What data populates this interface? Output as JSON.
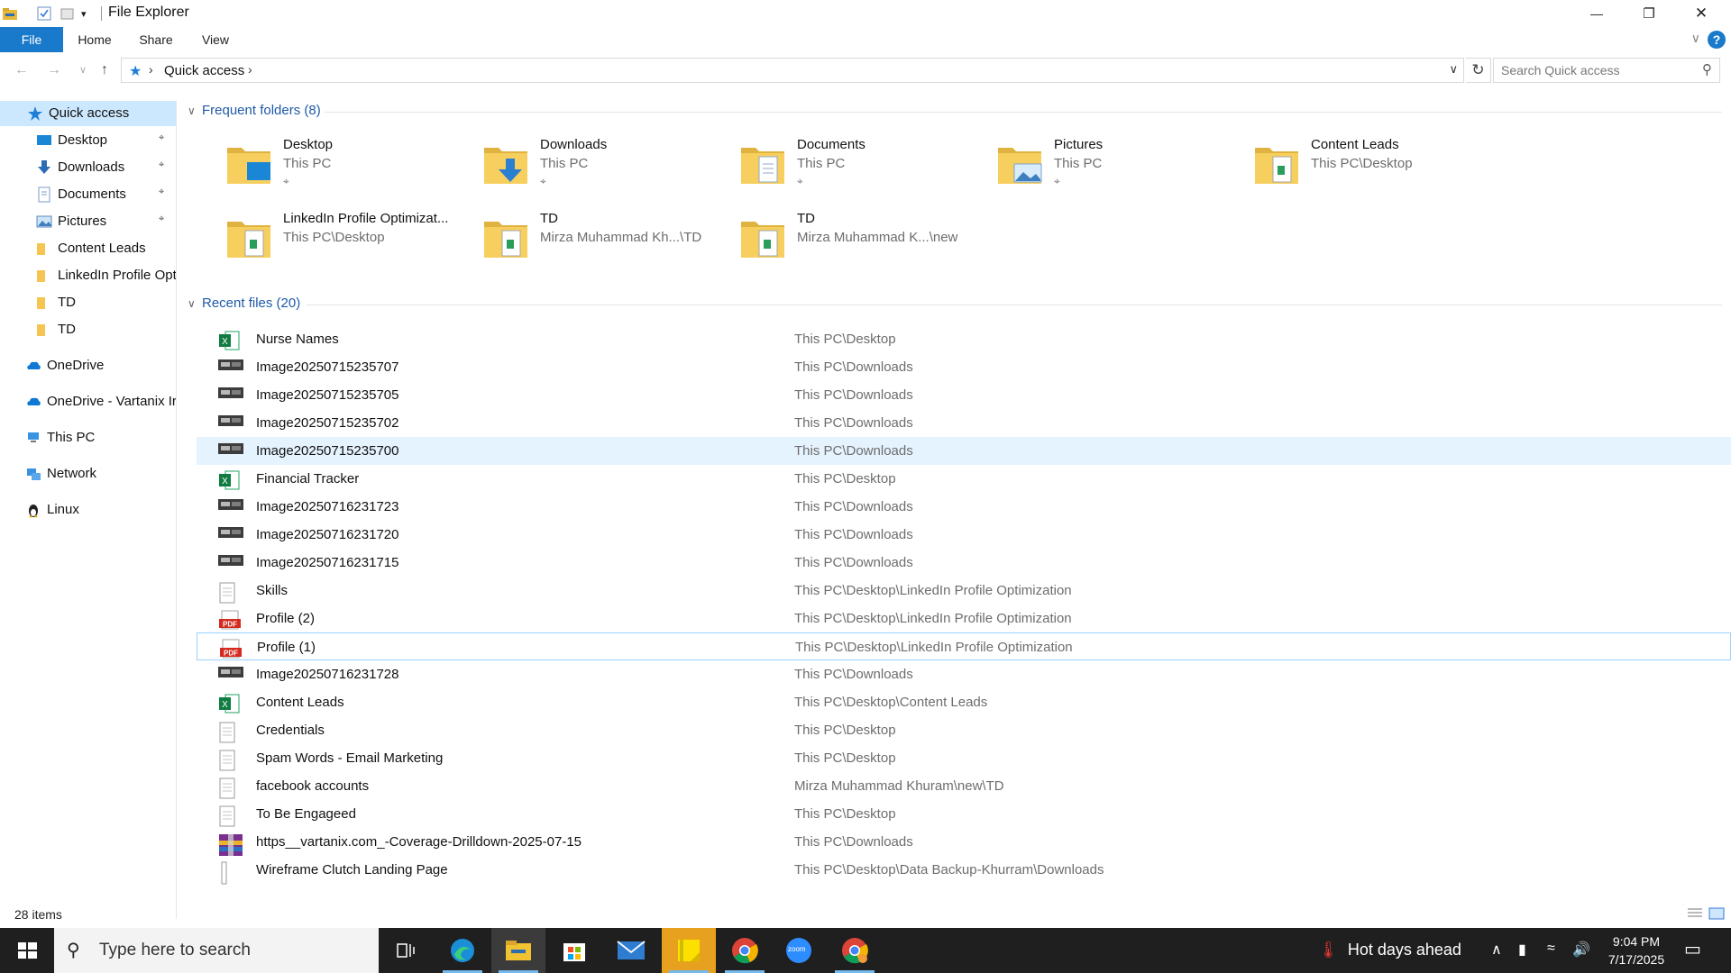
{
  "window": {
    "title": "File Explorer",
    "minimize": "—",
    "maximize": "❐",
    "close": "✕"
  },
  "ribbon": {
    "tabs": [
      "File",
      "Home",
      "Share",
      "View"
    ],
    "help": "?",
    "collapse": "∨"
  },
  "address": {
    "path": "Quick access",
    "chevron": "›",
    "dropdown": "∨",
    "refresh": "↻",
    "search_placeholder": "Search Quick access",
    "search_icon": "⌕",
    "back": "←",
    "forward": "→",
    "recent": "∨",
    "up": "↑"
  },
  "nav": {
    "items": [
      {
        "label": "Quick access",
        "icon": "quick-access-star-icon",
        "selected": true
      },
      {
        "label": "Desktop",
        "icon": "desktop-icon",
        "pinned": true
      },
      {
        "label": "Downloads",
        "icon": "downloads-icon",
        "pinned": true
      },
      {
        "label": "Documents",
        "icon": "documents-icon",
        "pinned": true
      },
      {
        "label": "Pictures",
        "icon": "pictures-icon",
        "pinned": true
      },
      {
        "label": "Content Leads",
        "icon": "folder-icon"
      },
      {
        "label": "LinkedIn Profile Opt",
        "icon": "folder-icon"
      },
      {
        "label": "TD",
        "icon": "folder-icon"
      },
      {
        "label": "TD",
        "icon": "folder-icon"
      },
      {
        "label": "OneDrive",
        "icon": "onedrive-icon"
      },
      {
        "label": "OneDrive - Vartanix Ir",
        "icon": "onedrive-icon"
      },
      {
        "label": "This PC",
        "icon": "this-pc-icon"
      },
      {
        "label": "Network",
        "icon": "network-icon"
      },
      {
        "label": "Linux",
        "icon": "linux-icon"
      }
    ],
    "pin_glyph": "📌"
  },
  "frequent": {
    "header": "Frequent folders (8)",
    "folders": [
      {
        "name": "Desktop",
        "path": "This PC",
        "pinned": true,
        "icon": "desktop-folder-icon"
      },
      {
        "name": "Downloads",
        "path": "This PC",
        "pinned": true,
        "icon": "downloads-folder-icon"
      },
      {
        "name": "Documents",
        "path": "This PC",
        "pinned": true,
        "icon": "documents-folder-icon"
      },
      {
        "name": "Pictures",
        "path": "This PC",
        "pinned": true,
        "icon": "pictures-folder-icon"
      },
      {
        "name": "Content Leads",
        "path": "This PC\\Desktop",
        "pinned": false,
        "icon": "folder-icon"
      },
      {
        "name": "LinkedIn Profile Optimizat...",
        "path": "This PC\\Desktop",
        "pinned": false,
        "icon": "folder-icon"
      },
      {
        "name": "TD",
        "path": "Mirza Muhammad Kh...\\TD",
        "pinned": false,
        "icon": "folder-icon"
      },
      {
        "name": "TD",
        "path": "Mirza Muhammad K...\\new",
        "pinned": false,
        "icon": "folder-icon"
      }
    ]
  },
  "recent": {
    "header": "Recent files (20)",
    "files": [
      {
        "name": "Nurse Names",
        "location": "This PC\\Desktop",
        "type": "excel"
      },
      {
        "name": "Image20250715235707",
        "location": "This PC\\Downloads",
        "type": "image"
      },
      {
        "name": "Image20250715235705",
        "location": "This PC\\Downloads",
        "type": "image"
      },
      {
        "name": "Image20250715235702",
        "location": "This PC\\Downloads",
        "type": "image"
      },
      {
        "name": "Image20250715235700",
        "location": "This PC\\Downloads",
        "type": "image",
        "hover": true
      },
      {
        "name": "Financial Tracker",
        "location": "This PC\\Desktop",
        "type": "excel"
      },
      {
        "name": "Image20250716231723",
        "location": "This PC\\Downloads",
        "type": "image"
      },
      {
        "name": "Image20250716231720",
        "location": "This PC\\Downloads",
        "type": "image"
      },
      {
        "name": "Image20250716231715",
        "location": "This PC\\Downloads",
        "type": "image"
      },
      {
        "name": "Skills",
        "location": "This PC\\Desktop\\LinkedIn Profile Optimization",
        "type": "text"
      },
      {
        "name": "Profile (2)",
        "location": "This PC\\Desktop\\LinkedIn Profile Optimization",
        "type": "pdf"
      },
      {
        "name": "Profile (1)",
        "location": "This PC\\Desktop\\LinkedIn Profile Optimization",
        "type": "pdf",
        "focus": true
      },
      {
        "name": "Image20250716231728",
        "location": "This PC\\Downloads",
        "type": "image"
      },
      {
        "name": "Content Leads",
        "location": "This PC\\Desktop\\Content Leads",
        "type": "excel"
      },
      {
        "name": "Credentials",
        "location": "This PC\\Desktop",
        "type": "text"
      },
      {
        "name": "Spam Words - Email Marketing",
        "location": "This PC\\Desktop",
        "type": "text"
      },
      {
        "name": "facebook accounts",
        "location": "Mirza Muhammad Khuram\\new\\TD",
        "type": "text"
      },
      {
        "name": "To Be Engageed",
        "location": "This PC\\Desktop",
        "type": "text"
      },
      {
        "name": "https__vartanix.com_-Coverage-Drilldown-2025-07-15",
        "location": "This PC\\Downloads",
        "type": "archive"
      },
      {
        "name": "Wireframe Clutch Landing Page",
        "location": "This PC\\Desktop\\Data Backup-Khurram\\Downloads",
        "type": "blank"
      }
    ]
  },
  "statusbar": {
    "items_count": "28 items"
  },
  "taskbar": {
    "search_placeholder": "Type here to search",
    "weather": "Hot days ahead",
    "time": "9:04 PM",
    "date": "7/17/2025",
    "apps": [
      "task-view-icon",
      "edge-icon",
      "file-explorer-icon",
      "store-icon",
      "mail-icon",
      "sticky-notes-icon",
      "chrome-icon",
      "zoom-icon",
      "chrome-profile-icon"
    ],
    "zoom_label": "zoom"
  },
  "colors": {
    "accent": "#1979ca",
    "selection": "#cce8ff",
    "hover": "#e5f3ff",
    "group_header": "#1e5aa8",
    "taskbar": "#1f1f1f"
  }
}
